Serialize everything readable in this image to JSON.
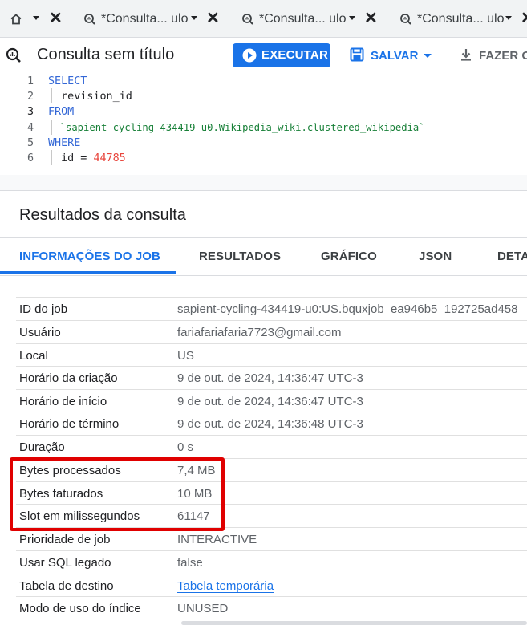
{
  "tabs": {
    "home_icon": "home-icon",
    "items": [
      {
        "label": "*Consulta... ulo"
      },
      {
        "label": "*Consulta... ulo"
      },
      {
        "label": "*Consulta... ulo"
      }
    ]
  },
  "toolbar": {
    "title": "Consulta sem título",
    "run_label": "EXECUTAR",
    "save_label": "SALVAR",
    "download_label": "FAZER O"
  },
  "editor": {
    "lines": [
      {
        "n": "1",
        "text": "SELECT"
      },
      {
        "n": "2",
        "text": "  revision_id"
      },
      {
        "n": "3",
        "text": "FROM"
      },
      {
        "n": "4",
        "text": "  `sapient-cycling-434419-u0.Wikipedia_wiki.clustered_wikipedia`"
      },
      {
        "n": "5",
        "text": "WHERE"
      },
      {
        "n": "6",
        "text_key": "  id = ",
        "text_val": "44785"
      }
    ]
  },
  "results": {
    "title": "Resultados da consulta",
    "tabs": [
      "INFORMAÇÕES DO JOB",
      "RESULTADOS",
      "GRÁFICO",
      "JSON",
      "DETA"
    ],
    "rows": [
      {
        "key": "ID do job",
        "value": "sapient-cycling-434419-u0:US.bquxjob_ea946b5_192725ad458"
      },
      {
        "key": "Usuário",
        "value": "fariafariafaria7723@gmail.com"
      },
      {
        "key": "Local",
        "value": "US"
      },
      {
        "key": "Horário da criação",
        "value": "9 de out. de 2024, 14:36:47 UTC-3"
      },
      {
        "key": "Horário de início",
        "value": "9 de out. de 2024, 14:36:47 UTC-3"
      },
      {
        "key": "Horário de término",
        "value": "9 de out. de 2024, 14:36:48 UTC-3"
      },
      {
        "key": "Duração",
        "value": "0 s"
      },
      {
        "key": "Bytes processados",
        "value": "7,4 MB"
      },
      {
        "key": "Bytes faturados",
        "value": "10 MB"
      },
      {
        "key": "Slot em milissegundos",
        "value": "61147"
      },
      {
        "key": "Prioridade de job",
        "value": "INTERACTIVE"
      },
      {
        "key": "Usar SQL legado",
        "value": "false"
      },
      {
        "key": "Tabela de destino",
        "value": "Tabela temporária"
      },
      {
        "key": "Modo de uso do índice",
        "value": "UNUSED"
      }
    ]
  },
  "colors": {
    "accent": "#1a73e8",
    "highlight": "#e00000",
    "keyword": "#3367d6",
    "string": "#188038",
    "number": "#e8453c"
  }
}
